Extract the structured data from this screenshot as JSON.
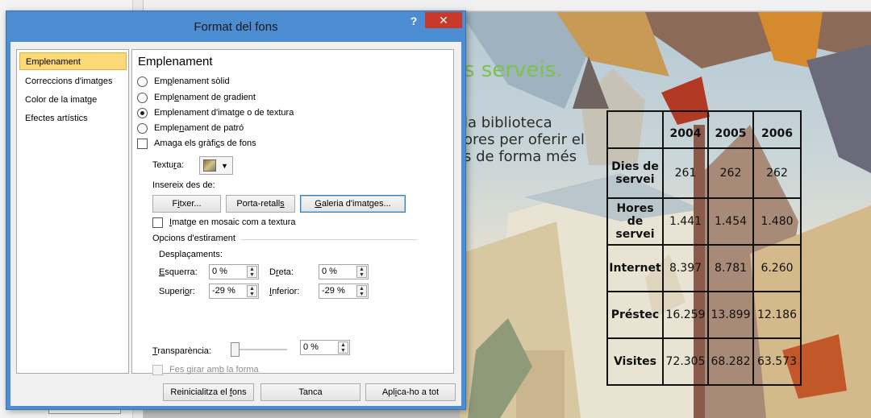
{
  "dialog": {
    "title": "Format del fons",
    "help": "?",
    "close": "✕"
  },
  "nav": {
    "items": [
      "Emplenament",
      "Correccions d'imatges",
      "Color de la imatge",
      "Efectes artístics"
    ]
  },
  "fill": {
    "heading": "Emplenament",
    "options": [
      {
        "pre": "Em",
        "key": "p",
        "post": "lenament sòlid"
      },
      {
        "pre": "Empl",
        "key": "e",
        "post": "nament de gradient"
      },
      {
        "pre": "Emplenament d'imat",
        "key": "g",
        "post": "e o de textura"
      },
      {
        "pre": "Emple",
        "key": "n",
        "post": "ament de patró"
      }
    ],
    "hide_graphics": {
      "pre": "Amaga els gràfi",
      "key": "c",
      "post": "s de fons"
    },
    "texture_label": {
      "pre": "Textu",
      "key": "r",
      "post": "a:"
    },
    "insert_from": "Insereix des de:",
    "buttons": {
      "file": {
        "pre": "F",
        "key": "i",
        "post": "txer..."
      },
      "clipboard": {
        "pre": "Porta-retall",
        "key": "s",
        "post": ""
      },
      "gallery": {
        "pre": "",
        "key": "G",
        "post": "aleria d'imatges..."
      }
    },
    "tile": {
      "pre": "",
      "key": "I",
      "post": "matge en mosaic com a textura"
    },
    "stretch_options": "Opcions d'estirament",
    "offsets": "Desplaçaments:",
    "left": {
      "pre": "",
      "key": "E",
      "post": "squerra:",
      "value": "0 %"
    },
    "right": {
      "pre": "D",
      "key": "r",
      "post": "eta:",
      "value": "0 %"
    },
    "top": {
      "pre": "Superi",
      "key": "o",
      "post": "r:",
      "value": "-29 %"
    },
    "bottom": {
      "pre": "",
      "key": "I",
      "post": "nferior:",
      "value": "-29 %"
    },
    "transparency": {
      "pre": "",
      "key": "T",
      "post": "ransparència:",
      "value": "0 %",
      "level": 0
    },
    "rotate": {
      "pre": "Fes girar am",
      "key": "b",
      "post": " la forma"
    }
  },
  "footer": {
    "reset": {
      "pre": "Reinicialitza el ",
      "key": "f",
      "post": "ons"
    },
    "close": "Tanca",
    "apply_all": {
      "pre": "Apl",
      "key": "i",
      "post": "ca-ho a tot"
    }
  },
  "slide": {
    "heading": "s serveis.",
    "body": [
      "la biblioteca",
      "ores per oferir el",
      "s de forma més"
    ],
    "table": {
      "headers": [
        "2004",
        "2005",
        "2006"
      ],
      "rows": [
        {
          "label": "Dies de servei",
          "values": [
            "261",
            "262",
            "262"
          ]
        },
        {
          "label": "Hores de servei",
          "values": [
            "1.441",
            "1.454",
            "1.480"
          ]
        },
        {
          "label": "Internet",
          "values": [
            "8.397",
            "8.781",
            "6.260"
          ]
        },
        {
          "label": "Préstec",
          "values": [
            "16.259",
            "13.899",
            "12.186"
          ]
        },
        {
          "label": "Visites",
          "values": [
            "72.305",
            "68.282",
            "63.573"
          ]
        }
      ]
    }
  },
  "colors": {
    "titlebar": "#4c8cd1",
    "close": "#c7392a",
    "selected": "#fcd977",
    "slide_heading": "#7dc24a"
  }
}
